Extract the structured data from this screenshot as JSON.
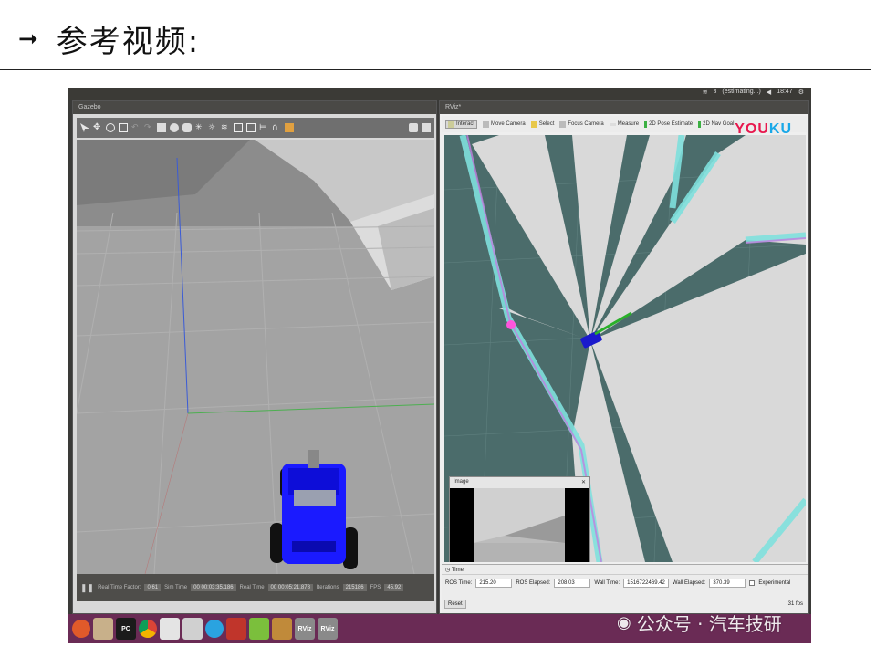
{
  "slide": {
    "bullet_icon": "arrow-right-icon",
    "title": "参考视频:"
  },
  "topbar": {
    "network": "(estimating...)",
    "time": "18:47"
  },
  "gazebo": {
    "window_title": "Gazebo",
    "status": {
      "real_time_factor_label": "Real Time Factor:",
      "real_time_factor": "0.61",
      "sim_time_label": "Sim Time",
      "sim_time": "00 00:03:35.186",
      "real_time_label": "Real Time",
      "real_time": "00 00:05:21.878",
      "iterations_label": "Iterations",
      "iterations": "215186",
      "fps_label": "FPS",
      "fps": "45.92"
    }
  },
  "rviz": {
    "window_title": "RViz*",
    "toolbar": [
      "Interact",
      "Move Camera",
      "Select",
      "Focus Camera",
      "Measure",
      "2D Pose Estimate",
      "2D Nav Goal"
    ],
    "overlay_brand_a": "YOU",
    "overlay_brand_b": "KU",
    "image_panel_title": "Image",
    "time_panel": {
      "title": "Time",
      "ros_time_label": "ROS Time:",
      "ros_time": "215.20",
      "ros_elapsed_label": "ROS Elapsed:",
      "ros_elapsed": "208.03",
      "wall_time_label": "Wall Time:",
      "wall_time": "1516722469.42",
      "wall_elapsed_label": "Wall Elapsed:",
      "wall_elapsed": "370.39",
      "experimental_label": "Experimental",
      "reset_label": "Reset",
      "fps": "31 fps"
    }
  },
  "dock": {
    "items": [
      {
        "name": "ubuntu-logo-icon",
        "label": ""
      },
      {
        "name": "files-icon",
        "label": ""
      },
      {
        "name": "pycharm-icon",
        "label": "PC"
      },
      {
        "name": "chrome-icon",
        "label": ""
      },
      {
        "name": "drive-icon",
        "label": ""
      },
      {
        "name": "drive-icon-2",
        "label": ""
      },
      {
        "name": "telegram-icon",
        "label": ""
      },
      {
        "name": "terminal-icon",
        "label": ""
      },
      {
        "name": "gazebo-icon",
        "label": ""
      },
      {
        "name": "package-icon",
        "label": ""
      },
      {
        "name": "rviz-icon",
        "label": "RViz"
      },
      {
        "name": "rviz-icon-2",
        "label": "RViz"
      }
    ]
  },
  "watermark": {
    "text": "公众号 · 汽车技研"
  },
  "colors": {
    "dock_bg": "#6a2b55",
    "robot_blue": "#1a1aff",
    "map_free": "#d9d9d9",
    "map_unknown": "#4b6c6b",
    "map_inflation": "#7fe0dd"
  }
}
